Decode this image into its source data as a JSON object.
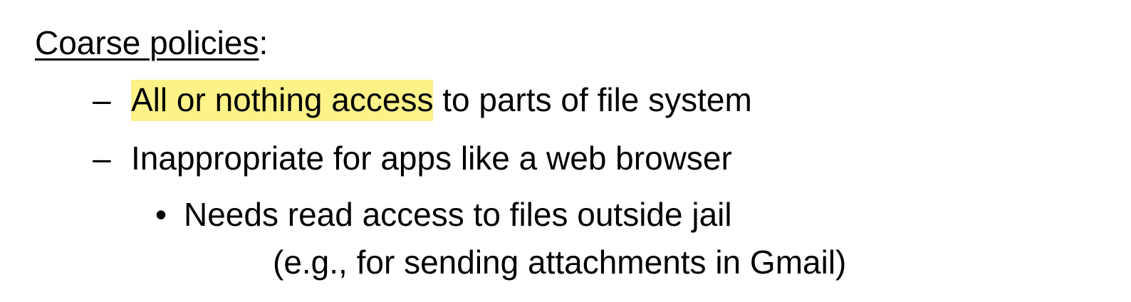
{
  "heading": {
    "title": "Coarse policies",
    "colon": ":"
  },
  "bullets": [
    {
      "marker": "–",
      "highlighted": "All or nothing access",
      "rest": " to parts of file system"
    },
    {
      "marker": "–",
      "text": "Inappropriate for apps like a web browser"
    }
  ],
  "sub_bullet": {
    "marker": "•",
    "line1": "Needs read access to files outside jail",
    "line2": "(e.g., for sending attachments in Gmail)"
  },
  "colors": {
    "highlight": "#fcf288",
    "text": "#000000",
    "background": "#ffffff"
  }
}
